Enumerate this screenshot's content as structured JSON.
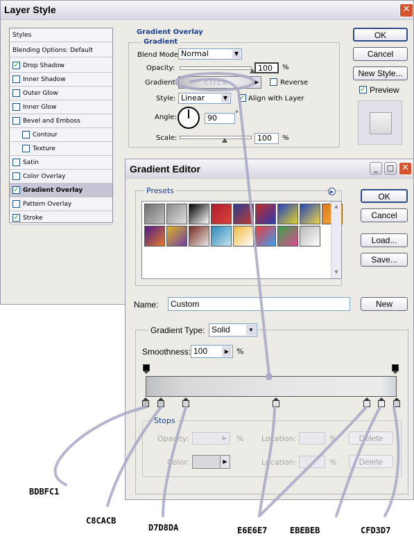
{
  "layer_style": {
    "title": "Layer Style",
    "styles_header": "Styles",
    "blending_options": "Blending Options: Default",
    "list": [
      {
        "label": "Drop Shadow",
        "checked": true
      },
      {
        "label": "Inner Shadow",
        "checked": false
      },
      {
        "label": "Outer Glow",
        "checked": false
      },
      {
        "label": "Inner Glow",
        "checked": false
      },
      {
        "label": "Bevel and Emboss",
        "checked": false
      },
      {
        "label": "Contour",
        "checked": false
      },
      {
        "label": "Texture",
        "checked": false
      },
      {
        "label": "Satin",
        "checked": false
      },
      {
        "label": "Color Overlay",
        "checked": false
      },
      {
        "label": "Gradient Overlay",
        "checked": true
      },
      {
        "label": "Pattern Overlay",
        "checked": false
      },
      {
        "label": "Stroke",
        "checked": true
      }
    ],
    "section_title": "Gradient Overlay",
    "subsection_title": "Gradient",
    "blend_mode_label": "Blend Mode:",
    "blend_mode_value": "Normal",
    "opacity_label": "Opacity:",
    "opacity_value": "100",
    "percent": "%",
    "gradient_label": "Gradient:",
    "click_label": "click",
    "reverse_label": "Reverse",
    "style_label": "Style:",
    "style_value": "Linear",
    "align_label": "Align with Layer",
    "angle_label": "Angle:",
    "angle_value": "90",
    "degree": "°",
    "scale_label": "Scale:",
    "scale_value": "100",
    "ok": "OK",
    "cancel": "Cancel",
    "new_style": "New Style...",
    "preview_label": "Preview",
    "opacity_level": 1.0,
    "scale_level": 0.5
  },
  "gradient_editor": {
    "title": "Gradient Editor",
    "presets_label": "Presets",
    "ok": "OK",
    "cancel": "Cancel",
    "load": "Load...",
    "save": "Save...",
    "name_label": "Name:",
    "name_value": "Custom",
    "new_button": "New",
    "gradient_type_label": "Gradient Type:",
    "gradient_type_value": "Solid",
    "smoothness_label": "Smoothness:",
    "smoothness_value": "100",
    "percent": "%",
    "stops_label": "Stops",
    "opacity_label": "Opacity:",
    "location_label": "Location:",
    "delete_label": "Delete",
    "color_label": "Color:",
    "color_stops": [
      {
        "color": "#BDBFC1",
        "position": 0.0
      },
      {
        "color": "#C8CACB",
        "position": 0.06
      },
      {
        "color": "#D7D8DA",
        "position": 0.16
      },
      {
        "color": "#E6E6E7",
        "position": 0.52
      },
      {
        "color": "#EBEBEB",
        "position": 0.88
      },
      {
        "color": "#EBEBEB",
        "position": 0.94
      },
      {
        "color": "#CFD3D7",
        "position": 1.0
      }
    ],
    "preset_colors": [
      [
        "#6f6f6f",
        "#bfbfbf"
      ],
      [
        "#8a8a8a",
        "#e0e0e0"
      ],
      [
        "#000000",
        "#ffffff"
      ],
      [
        "#b11c2a",
        "#d7433c"
      ],
      [
        "#283c93",
        "#c43b2a"
      ],
      [
        "#c42a2a",
        "#2a3bb0"
      ],
      [
        "#213fbf",
        "#e3d32a"
      ],
      [
        "#1f46b8",
        "#f2d34a"
      ],
      [
        "#e07a1d",
        "#f0b23a"
      ],
      [
        "#4d1b89",
        "#e27a2a"
      ],
      [
        "#e0b41f",
        "#6c3fa8"
      ],
      [
        "#7a2a1f",
        "#e6e6e6"
      ],
      [
        "#2a88b8",
        "#c2e3ef"
      ],
      [
        "#f1b93d",
        "#ffffff"
      ],
      [
        "#ee3d3d",
        "#3d9cee"
      ],
      [
        "#36a24a",
        "#e04a90"
      ],
      [
        "#b8b8b8",
        "#ffffff"
      ]
    ]
  },
  "annotations": [
    "BDBFC1",
    "C8CACB",
    "D7D8DA",
    "E6E6E7",
    "EBEBEB",
    "CFD3D7"
  ]
}
